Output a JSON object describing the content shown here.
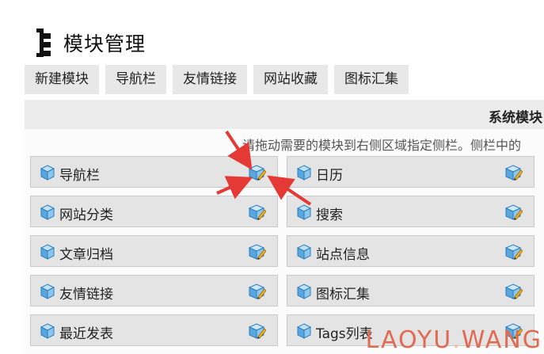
{
  "page": {
    "title": "模块管理",
    "icon": "sitemap-icon"
  },
  "tabs": [
    {
      "label": "新建模块"
    },
    {
      "label": "导航栏"
    },
    {
      "label": "友情链接"
    },
    {
      "label": "网站收藏"
    },
    {
      "label": "图标汇集"
    }
  ],
  "panel": {
    "title": "系统模块",
    "hint": "请拖动需要的模块到右侧区域指定侧栏。侧栏中的"
  },
  "widgets_left": [
    {
      "label": "导航栏"
    },
    {
      "label": "网站分类"
    },
    {
      "label": "文章归档"
    },
    {
      "label": "友情链接"
    },
    {
      "label": "最近发表"
    }
  ],
  "widgets_right": [
    {
      "label": "日历"
    },
    {
      "label": "搜索"
    },
    {
      "label": "站点信息"
    },
    {
      "label": "图标汇集"
    },
    {
      "label": "Tags列表"
    }
  ],
  "icons": {
    "module": "cube-icon",
    "edit": "edit-pencil-icon"
  },
  "watermark": {
    "text_main": "LAOYU",
    "text_sep": ".",
    "text_tail": "WANG"
  },
  "colors": {
    "tab_bg": "#e8e8e8",
    "widget_bg": "#e4e4e4",
    "arrow": "#e53935",
    "watermark": "#e26a50"
  }
}
